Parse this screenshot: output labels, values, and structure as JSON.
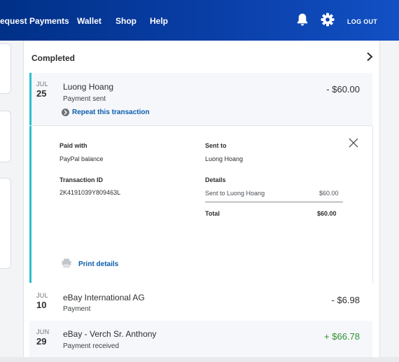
{
  "nav": {
    "links": [
      "equest Payments",
      "Wallet",
      "Shop",
      "Help"
    ],
    "logout_label": "LOG OUT",
    "icons": [
      "bell-icon",
      "gear-icon"
    ]
  },
  "colors": {
    "nav_bg": "#003087",
    "accent_teal": "#2cbfcf",
    "link_blue": "#0b5cad",
    "positive_green": "#2f8f2f"
  },
  "section": {
    "title": "Completed"
  },
  "transactions": [
    {
      "month": "JUL",
      "day": "25",
      "name": "Luong Hoang",
      "type": "Payment sent",
      "amount": "- $60.00",
      "repeat_label": "Repeat this transaction",
      "expanded": true
    },
    {
      "month": "JUL",
      "day": "10",
      "name": "eBay International AG",
      "type": "Payment",
      "amount": "- $6.98"
    },
    {
      "month": "JUN",
      "day": "29",
      "name": "eBay - Verch Sr. Anthony",
      "type": "Payment received",
      "amount": "+ $66.78"
    }
  ],
  "details": {
    "paid_with_label": "Paid with",
    "paid_with_value": "PayPal balance",
    "txn_id_label": "Transaction ID",
    "txn_id_value": "2K4191039Y809463L",
    "sent_to_label": "Sent to",
    "sent_to_value": "Luong Hoang",
    "details_label": "Details",
    "line_item_label": "Sent to Luong Hoang",
    "line_item_amount": "$60.00",
    "total_label": "Total",
    "total_amount": "$60.00",
    "print_label": "Print details"
  }
}
